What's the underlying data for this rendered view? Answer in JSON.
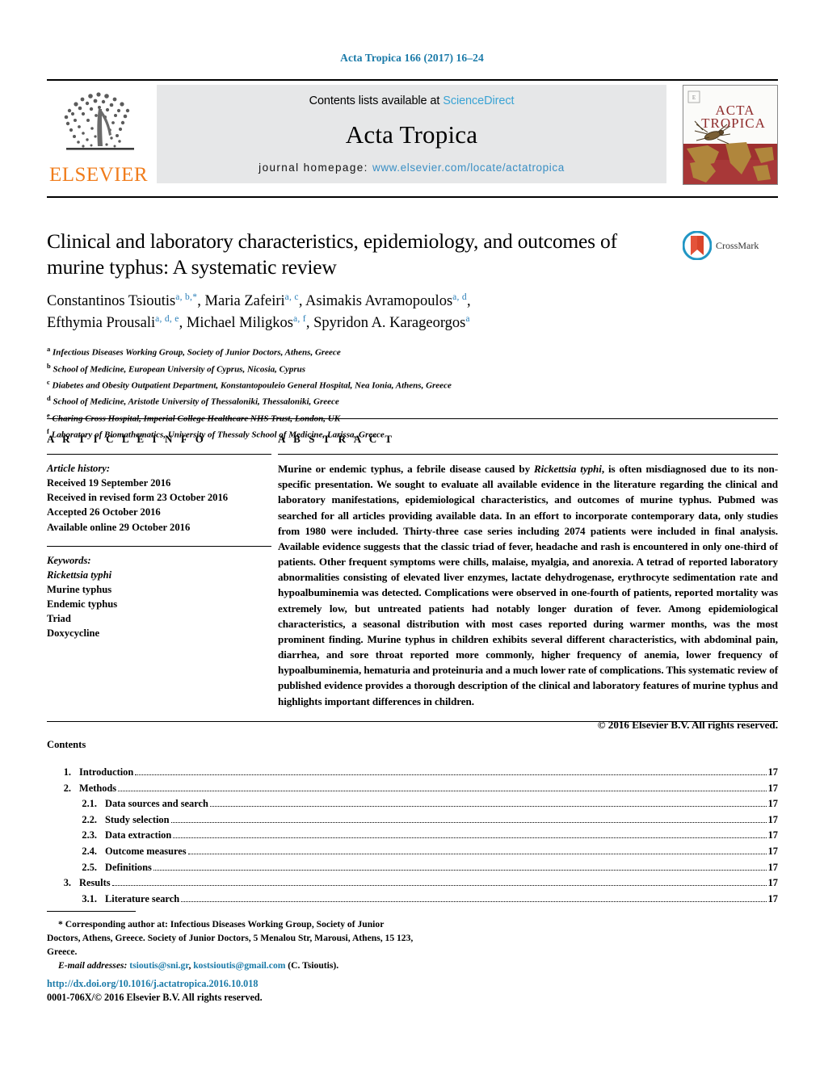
{
  "running_head": "Acta Tropica 166 (2017) 16–24",
  "masthead": {
    "contents_prefix": "Contents lists available at ",
    "sciencedirect": "ScienceDirect",
    "journal_title": "Acta Tropica",
    "homepage_prefix": "journal homepage:",
    "homepage_url": "www.elsevier.com/locate/actatropica",
    "elsevier_word": "ELSEVIER",
    "cover_title_line1": "ACTA",
    "cover_title_line2": "TROPICA",
    "accent_link": "#3aa3d4",
    "accent_head": "#1a7aa8",
    "elsevier_orange": "#F07C1B"
  },
  "article": {
    "title": "Clinical and laboratory characteristics, epidemiology, and outcomes of murine typhus: A systematic review",
    "crossmark_label": "CrossMark",
    "authors_line1_part1": "Constantinos Tsioutis",
    "authors_line1_sup1": "a, b,*",
    "authors_line1_part2": ", Maria Zafeiri",
    "authors_line1_sup2": "a, c",
    "authors_line1_part3": ", Asimakis Avramopoulos",
    "authors_line1_sup3": "a, d",
    "authors_line1_tail": ",",
    "authors_line2_part1": "Efthymia Prousali",
    "authors_line2_sup1": "a, d, e",
    "authors_line2_part2": ", Michael Miligkos",
    "authors_line2_sup2": "a, f",
    "authors_line2_part3": ", Spyridon A. Karageorgos",
    "authors_line2_sup3": "a",
    "affiliations": [
      {
        "mark": "a",
        "text": "Infectious Diseases Working Group, Society of Junior Doctors, Athens, Greece"
      },
      {
        "mark": "b",
        "text": "School of Medicine, European University of Cyprus, Nicosia, Cyprus"
      },
      {
        "mark": "c",
        "text": "Diabetes and Obesity Outpatient Department, Konstantopouleio General Hospital, Nea Ionia, Athens, Greece"
      },
      {
        "mark": "d",
        "text": "School of Medicine, Aristotle University of Thessaloniki, Thessaloniki, Greece"
      },
      {
        "mark": "e",
        "text": "Charing Cross Hospital, Imperial College Healthcare NHS Trust, London, UK"
      },
      {
        "mark": "f",
        "text": "Laboratory of Biomathematics, University of Thessaly School of Medicine, Larissa, Greece"
      }
    ]
  },
  "article_info": {
    "heading": "A R T I C L E   I N F O",
    "history_label": "Article history:",
    "history": [
      "Received 19 September 2016",
      "Received in revised form 23 October 2016",
      "Accepted 26 October 2016",
      "Available online 29 October 2016"
    ],
    "keywords_label": "Keywords:",
    "keywords": [
      "Rickettsia typhi",
      "Murine typhus",
      "Endemic typhus",
      "Triad",
      "Doxycycline"
    ]
  },
  "abstract": {
    "heading": "A B S T R A C T",
    "part1": "Murine or endemic typhus, a febrile disease caused by ",
    "italic1": "Rickettsia typhi",
    "part2": ", is often misdiagnosed due to its non-specific presentation. We sought to evaluate all available evidence in the literature regarding the clinical and laboratory manifestations, epidemiological characteristics, and outcomes of murine typhus. Pubmed was searched for all articles providing available data. In an effort to incorporate contemporary data, only studies from 1980 were included. Thirty-three case series including 2074 patients were included in final analysis. Available evidence suggests that the classic triad of fever, headache and rash is encountered in only one-third of patients. Other frequent symptoms were chills, malaise, myalgia, and anorexia. A tetrad of reported laboratory abnormalities consisting of elevated liver enzymes, lactate dehydrogenase, erythrocyte sedimentation rate and hypoalbuminemia was detected. Complications were observed in one-fourth of patients, reported mortality was extremely low, but untreated patients had notably longer duration of fever. Among epidemiological characteristics, a seasonal distribution with most cases reported during warmer months, was the most prominent finding. Murine typhus in children exhibits several different characteristics, with abdominal pain, diarrhea, and sore throat reported more commonly, higher frequency of anemia, lower frequency of hypoalbuminemia, hematuria and proteinuria and a much lower rate of complications. This systematic review of published evidence provides a thorough description of the clinical and laboratory features of murine typhus and highlights important differences in children.",
    "copyright": "© 2016 Elsevier B.V. All rights reserved."
  },
  "contents": {
    "heading": "Contents",
    "entries": [
      {
        "num": "1.",
        "label": "Introduction",
        "page": "17",
        "level": 1
      },
      {
        "num": "2.",
        "label": "Methods",
        "page": "17",
        "level": 1
      },
      {
        "num": "2.1.",
        "label": "Data sources and search",
        "page": "17",
        "level": 2
      },
      {
        "num": "2.2.",
        "label": "Study selection",
        "page": "17",
        "level": 2
      },
      {
        "num": "2.3.",
        "label": "Data extraction",
        "page": "17",
        "level": 2
      },
      {
        "num": "2.4.",
        "label": "Outcome measures",
        "page": "17",
        "level": 2
      },
      {
        "num": "2.5.",
        "label": "Definitions",
        "page": "17",
        "level": 2
      },
      {
        "num": "3.",
        "label": "Results",
        "page": "17",
        "level": 1
      },
      {
        "num": "3.1.",
        "label": "Literature search",
        "page": "17",
        "level": 2
      }
    ]
  },
  "footnotes": {
    "corresponding": "* Corresponding author at: Infectious Diseases Working Group, Society of Junior Doctors, Athens, Greece. Society of Junior Doctors, 5 Menalou Str, Marousi, Athens, 15 123, Greece.",
    "email_label": "E-mail addresses:",
    "email1": "tsioutis@sni.gr",
    "email_sep": ", ",
    "email2": "kostsioutis@gmail.com",
    "email_tail": " (C. Tsioutis).",
    "doi": "http://dx.doi.org/10.1016/j.actatropica.2016.10.018",
    "issn_copyright": "0001-706X/© 2016 Elsevier B.V. All rights reserved."
  }
}
